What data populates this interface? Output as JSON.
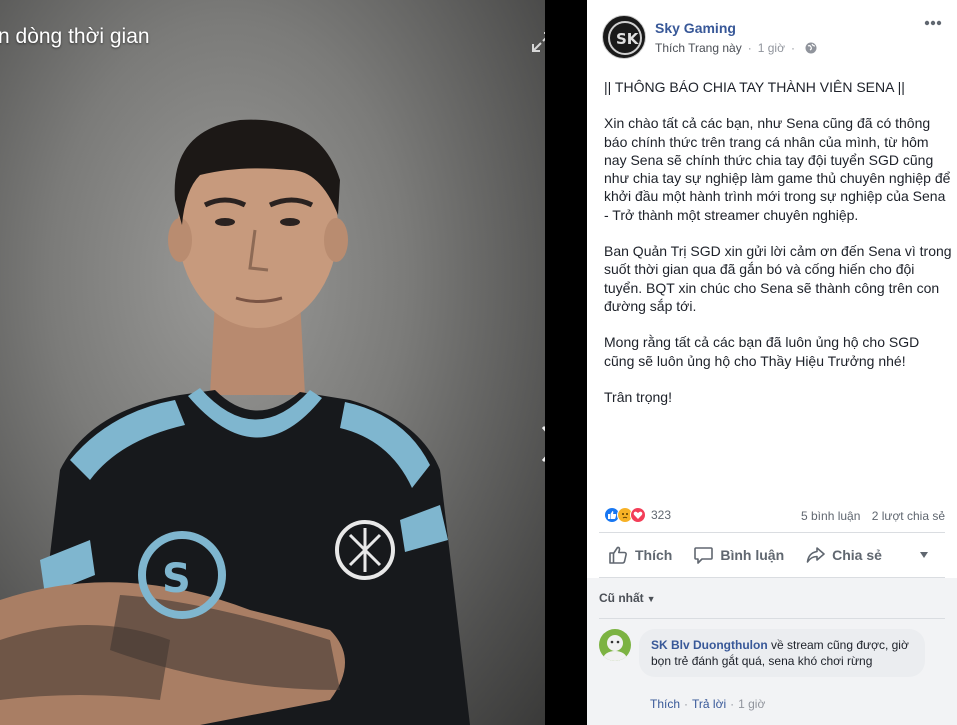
{
  "viewer": {
    "title": "n dòng thời gian"
  },
  "post": {
    "page_name": "Sky Gaming",
    "like_page": "Thích Trang này",
    "time": "1 giờ",
    "paragraphs": [
      "|| THÔNG BÁO CHIA TAY THÀNH VIÊN SENA ||",
      "Xin chào tất cả các bạn, như Sena cũng đã có thông báo chính thức trên trang cá nhân của mình, từ hôm nay Sena sẽ chính thức chia tay đội tuyển SGD cũng như chia tay sự nghiệp làm game thủ chuyên nghiệp để khởi đầu một hành trình mới trong sự nghiệp của Sena - Trở thành một streamer chuyên nghiệp.",
      "Ban Quản Trị SGD xin gửi lời cảm ơn đến Sena vì trong suốt thời gian qua đã gắn bó và cống hiến cho đội tuyển. BQT xin chúc cho Sena sẽ thành công trên con đường sắp tới.",
      "Mong rằng tất cả các bạn đã luôn ủng hộ cho SGD cũng sẽ luôn ủng hộ cho Thầy Hiệu Trưởng nhé!",
      "Trân trọng!"
    ],
    "reaction_count": "323",
    "comments_count": "5 bình luận",
    "shares_count": "2 lượt chia sẻ",
    "actions": {
      "like": "Thích",
      "comment": "Bình luận",
      "share": "Chia sẻ"
    }
  },
  "comments": {
    "sort_label": "Cũ nhất",
    "items": [
      {
        "author": "SK Blv Duongthulon",
        "text": " về stream cũng được, giờ bọn trẻ đánh gắt quá, sena khó chơi rừng",
        "like": "Thích",
        "reply": "Trả lời",
        "time": "1 giờ"
      }
    ]
  },
  "colors": {
    "link": "#385898",
    "jersey_accent": "#7fb6cf",
    "like_blue": "#1877f2",
    "love_red": "#f33e58",
    "sad_yellow": "#f7b125"
  },
  "icons": [
    "expand-icon",
    "chevron-right-icon",
    "more-options-icon",
    "globe-icon",
    "like-icon",
    "comment-icon",
    "share-icon",
    "caret-down-icon"
  ]
}
